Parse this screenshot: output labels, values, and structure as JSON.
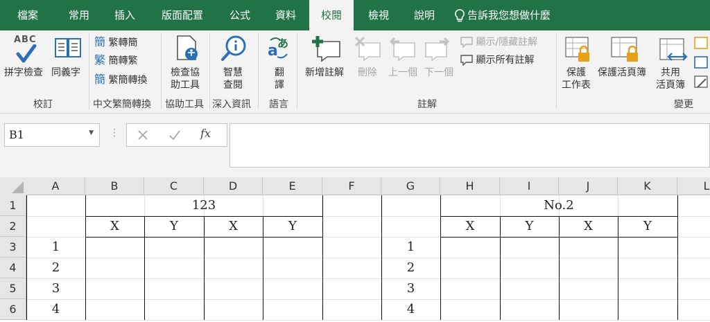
{
  "menu": {
    "tabs": [
      "檔案",
      "常用",
      "插入",
      "版面配置",
      "公式",
      "資料",
      "校閱",
      "檢視",
      "說明"
    ],
    "active_tab": "校閱",
    "tell_me": "告訴我您想做什麼"
  },
  "ribbon": {
    "proofing": {
      "spelling_icon_text": "ABC",
      "spelling": "拼字檢查",
      "thesaurus": "同義字",
      "group": "校訂"
    },
    "chinese_conversion": {
      "icon_1": "簡",
      "icon_2": "繁",
      "icon_3": "簡",
      "to_traditional": "繁轉簡",
      "to_simplified": "簡轉繁",
      "convert": "繁簡轉換",
      "group": "中文繁簡轉換"
    },
    "accessibility": {
      "check_line1": "檢查協",
      "check_line2": "助工具",
      "group": "協助工具"
    },
    "insights": {
      "smart_line1": "智慧",
      "smart_line2": "查閱",
      "group": "深入資訊"
    },
    "language": {
      "translate_line1": "翻",
      "translate_line2": "譯",
      "group": "語言"
    },
    "comments": {
      "new": "新增註解",
      "delete": "刪除",
      "previous": "上一個",
      "next": "下一個",
      "show_hide": "顯示/隱藏註解",
      "show_all": "顯示所有註解",
      "group": "註解"
    },
    "changes": {
      "protect_sheet_line1": "保護",
      "protect_sheet_line2": "工作表",
      "protect_workbook": "保護活頁簿",
      "share_line1": "共用",
      "share_line2": "活頁簿",
      "group": "變更"
    }
  },
  "formula_bar": {
    "name_box": "B1",
    "formula": ""
  },
  "sheet": {
    "columns": [
      "A",
      "B",
      "C",
      "D",
      "E",
      "F",
      "G",
      "H",
      "I",
      "J",
      "K",
      "L"
    ],
    "rows": [
      "1",
      "2",
      "3",
      "4",
      "5",
      "6"
    ],
    "table1": {
      "title": "123",
      "headers": [
        "X",
        "Y",
        "X",
        "Y"
      ],
      "index": [
        "1",
        "2",
        "3",
        "4"
      ]
    },
    "table2": {
      "title": "No.2",
      "headers": [
        "X",
        "Y",
        "X",
        "Y"
      ],
      "index": [
        "1",
        "2",
        "3",
        "4"
      ]
    }
  },
  "colors": {
    "brand": "#217346",
    "ribbon_bg": "#f3f3f3"
  }
}
